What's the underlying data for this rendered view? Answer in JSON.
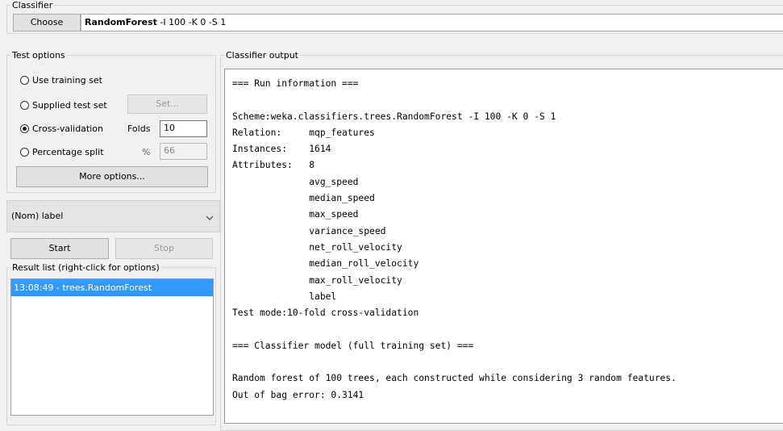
{
  "classifier": {
    "group_label": "Classifier",
    "choose_label": "Choose",
    "name": "RandomForest",
    "options": " -I 100 -K 0 -S 1"
  },
  "test_options": {
    "group_label": "Test options",
    "use_training_set": "Use training set",
    "supplied_test_set": "Supplied test set",
    "set_button": "Set...",
    "cross_validation": "Cross-validation",
    "folds_label": "Folds",
    "folds_value": "10",
    "percentage_split": "Percentage split",
    "percent_symbol": "%",
    "percent_value": "66",
    "selected": "cross_validation",
    "more_options": "More options..."
  },
  "class_attribute": {
    "selected": "(Nom) label"
  },
  "run_controls": {
    "start": "Start",
    "stop": "Stop"
  },
  "result_list": {
    "group_label": "Result list (right-click for options)",
    "items": [
      "13:08:49 - trees.RandomForest"
    ]
  },
  "classifier_output": {
    "group_label": "Classifier output",
    "lines": [
      "=== Run information ===",
      "",
      "Scheme:weka.classifiers.trees.RandomForest -I 100 -K 0 -S 1",
      "Relation:     mqp_features",
      "Instances:    1614",
      "Attributes:   8",
      "              avg_speed",
      "              median_speed",
      "              max_speed",
      "              variance_speed",
      "              net_roll_velocity",
      "              median_roll_velocity",
      "              max_roll_velocity",
      "              label",
      "Test mode:10-fold cross-validation",
      "",
      "=== Classifier model (full training set) ===",
      "",
      "Random forest of 100 trees, each constructed while considering 3 random features.",
      "Out of bag error: 0.3141"
    ]
  },
  "colors": {
    "selection": "#3399ff",
    "window_bg": "#f0f0f0"
  }
}
